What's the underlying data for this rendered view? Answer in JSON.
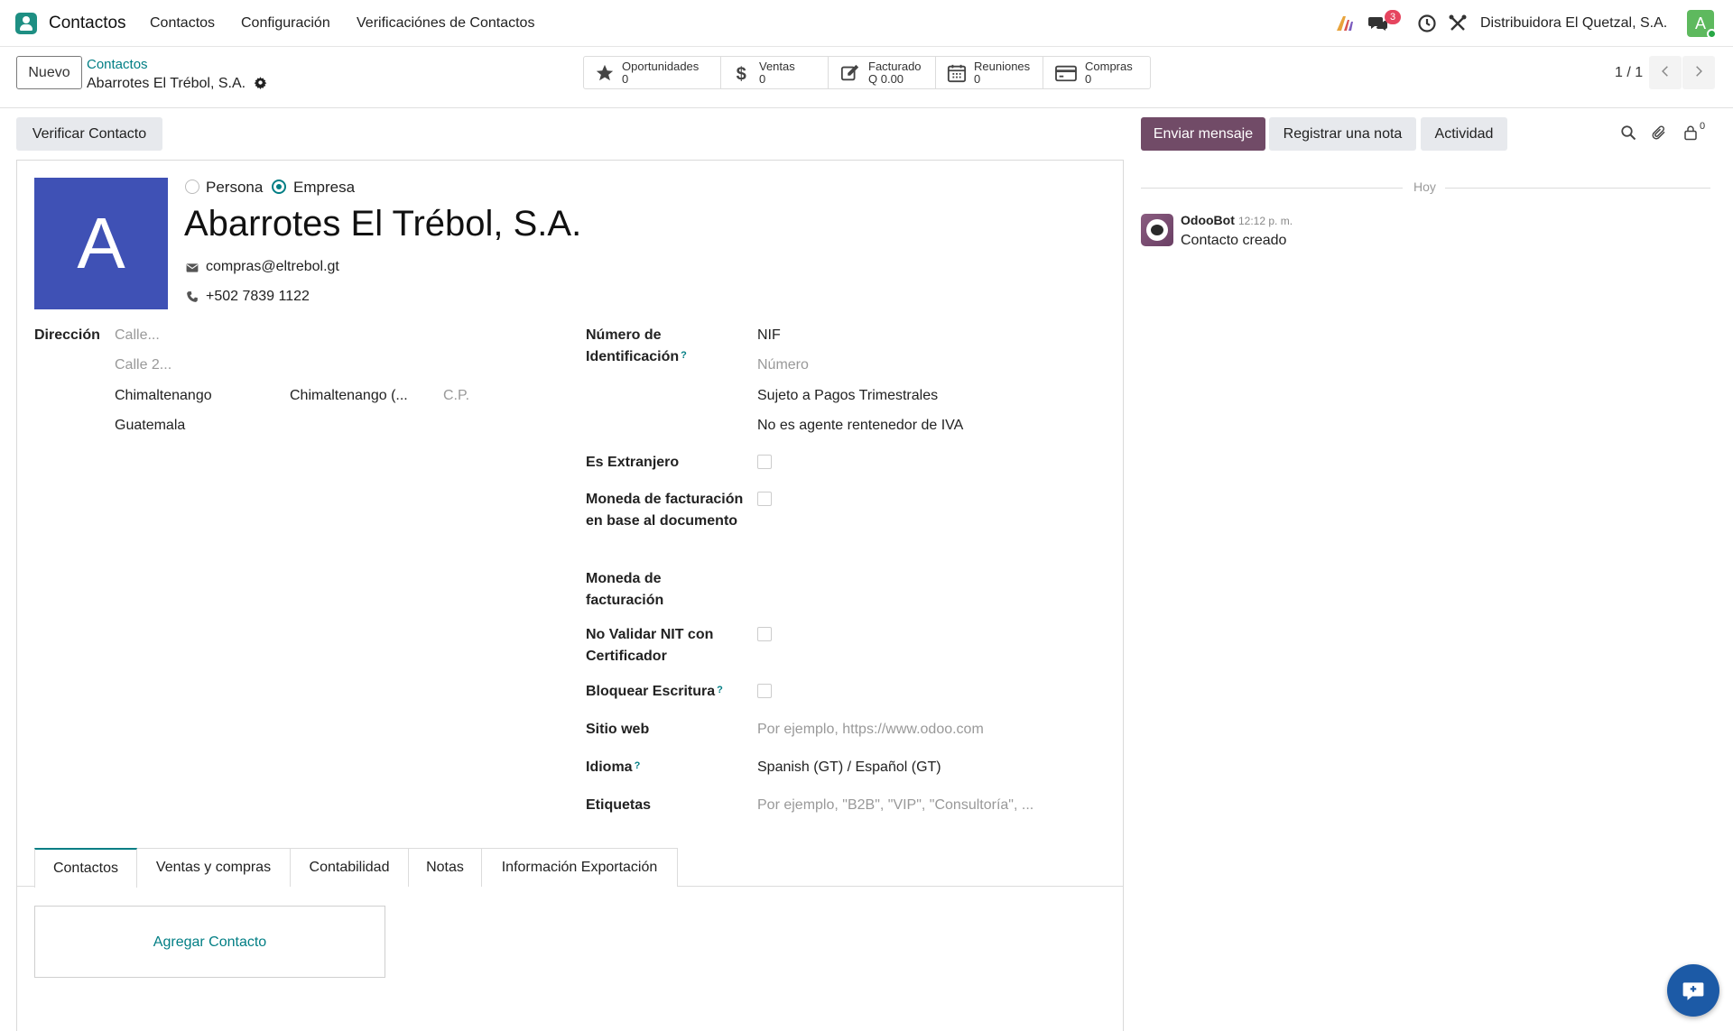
{
  "navbar": {
    "app_name": "Contactos",
    "menu": [
      "Contactos",
      "Configuración",
      "Verificaciónes de Contactos"
    ],
    "messages_badge": "3",
    "company": "Distribuidora El Quetzal, S.A.",
    "user_initial": "A"
  },
  "control_panel": {
    "new_button": "Nuevo",
    "breadcrumb_parent": "Contactos",
    "breadcrumb_current": "Abarrotes El Trébol, S.A.",
    "pager": "1 / 1",
    "smart_buttons": [
      {
        "label": "Oportunidades",
        "value": "0",
        "icon": "star-icon"
      },
      {
        "label": "Ventas",
        "value": "0",
        "icon": "dollar-icon"
      },
      {
        "label": "Facturado",
        "value": "Q 0.00",
        "icon": "pencil-square-icon"
      },
      {
        "label": "Reuniones",
        "value": "0",
        "icon": "calendar-icon"
      },
      {
        "label": "Compras",
        "value": "0",
        "icon": "credit-card-icon"
      }
    ]
  },
  "form": {
    "verify_button": "Verificar Contacto",
    "avatar_letter": "A",
    "type_person": "Persona",
    "type_company": "Empresa",
    "selected_type": "Empresa",
    "name": "Abarrotes El Trébol, S.A.",
    "email": "compras@eltrebol.gt",
    "phone": "+502 7839 1122",
    "address": {
      "label": "Dirección",
      "street_placeholder": "Calle...",
      "street2_placeholder": "Calle 2...",
      "city": "Chimaltenango",
      "state": "Chimaltenango (...",
      "zip_placeholder": "C.P.",
      "country": "Guatemala"
    },
    "id_number": {
      "label": "Número de Identificación",
      "type": "NIF",
      "placeholder": "Número"
    },
    "tax_regime": "Sujeto a Pagos Trimestrales",
    "iva_agent": "No es agente rentenedor de IVA",
    "foreign_label": "Es Extranjero",
    "currency_doc_label": "Moneda de facturación en base al documento",
    "currency_label": "Moneda de facturación",
    "no_validate_label": "No Validar NIT con Certificador",
    "lock_label": "Bloquear Escritura",
    "website_label": "Sitio web",
    "website_placeholder": "Por ejemplo, https://www.odoo.com",
    "language_label": "Idioma",
    "language_value": "Spanish (GT) / Español (GT)",
    "tags_label": "Etiquetas",
    "tags_placeholder": "Por ejemplo, \"B2B\", \"VIP\", \"Consultoría\", ...",
    "tabs": [
      "Contactos",
      "Ventas y compras",
      "Contabilidad",
      "Notas",
      "Información Exportación"
    ],
    "active_tab": "Contactos",
    "add_contact": "Agregar Contacto"
  },
  "chatter": {
    "send_message": "Enviar mensaje",
    "log_note": "Registrar una nota",
    "activity": "Actividad",
    "followers_count": "0",
    "day_label": "Hoy",
    "messages": [
      {
        "author": "OdooBot",
        "time": "12:12 p. m.",
        "body": "Contacto creado"
      }
    ]
  },
  "colors": {
    "primary": "#714b67",
    "accent": "#017e84",
    "avatar_bg": "#3f51b5"
  }
}
